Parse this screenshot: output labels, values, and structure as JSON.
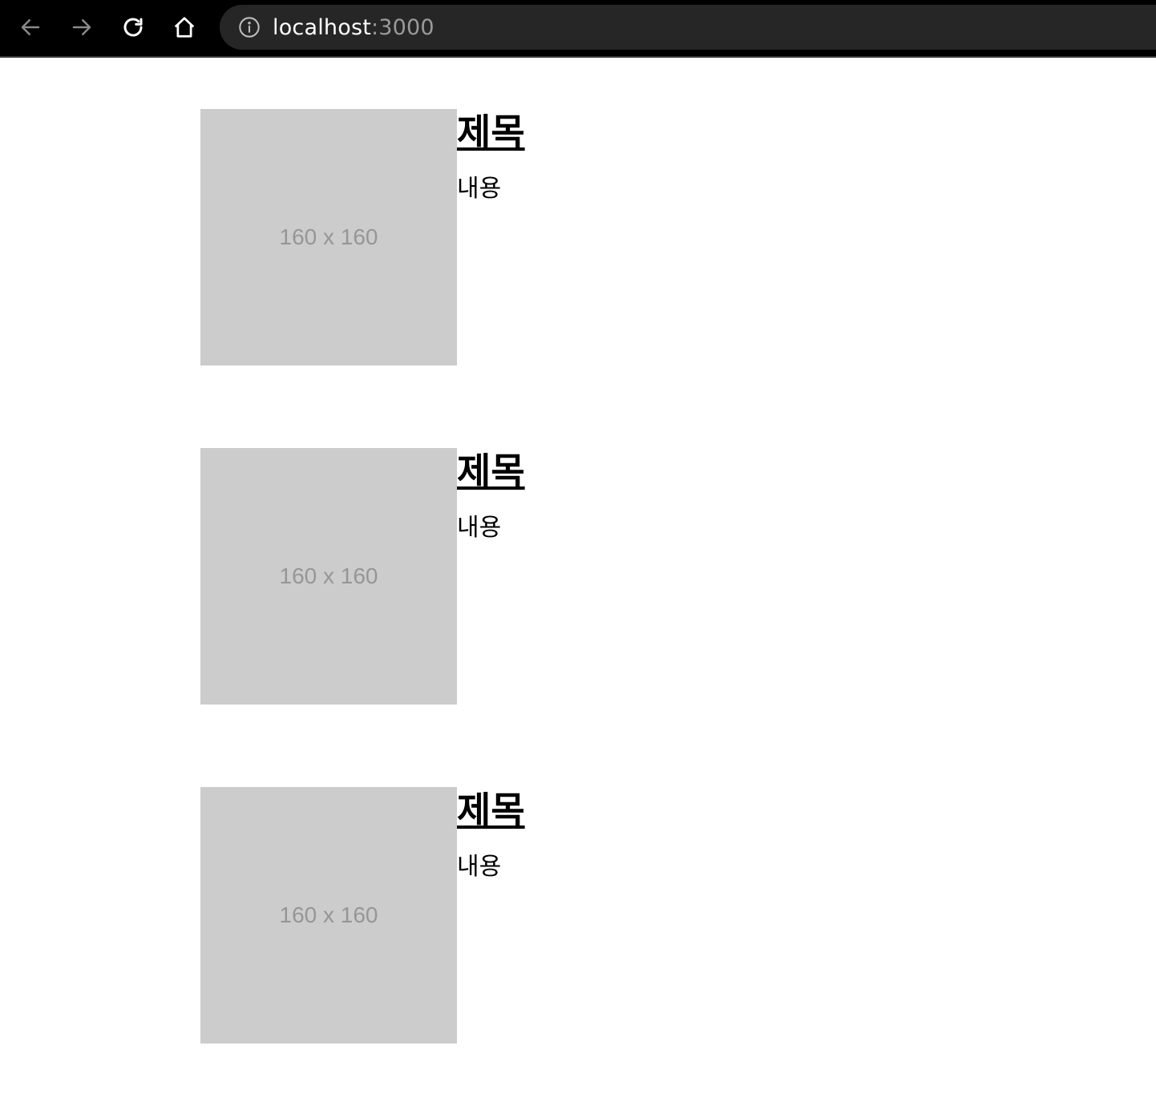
{
  "browser": {
    "url_host": "localhost",
    "url_port": ":3000",
    "icons": [
      "back-arrow-icon",
      "forward-arrow-icon",
      "reload-icon",
      "home-icon",
      "info-icon"
    ]
  },
  "cards": [
    {
      "title": "제목",
      "content": "내용",
      "image_label": "160 x 160"
    },
    {
      "title": "제목",
      "content": "내용",
      "image_label": "160 x 160"
    },
    {
      "title": "제목",
      "content": "내용",
      "image_label": "160 x 160"
    }
  ],
  "colors": {
    "toolbar_bg": "#000000",
    "address_bg": "#262626",
    "placeholder_bg": "#cccccc",
    "placeholder_text": "#969696"
  }
}
